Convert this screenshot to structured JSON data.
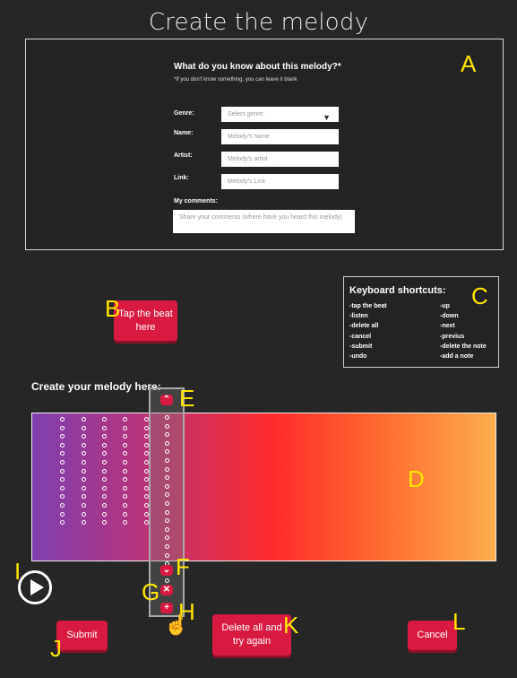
{
  "page": {
    "title": "Create the melody"
  },
  "form": {
    "question": "What do you know about this melody?*",
    "hint": "*If you don't know something, you can leave it blank",
    "genre_label": "Genre:",
    "genre_placeholder": "Select genre:",
    "name_label": "Name:",
    "name_placeholder": "Melody's name",
    "artist_label": "Artist:",
    "artist_placeholder": "Melody's artist",
    "link_label": "Link:",
    "link_placeholder": "Melody's Link",
    "comments_label": "My comments:",
    "comments_placeholder": "Share your comments (where have you heard this melody)"
  },
  "tap_button": "Tap the beat here",
  "shortcuts": {
    "title": "Keyboard shortcuts:",
    "left": [
      "-tap the beat",
      "-listen",
      "-delete all",
      "-cancel",
      "-submit",
      "-undo"
    ],
    "right": [
      "-up",
      "-down",
      "-next",
      "-previus",
      "-delete the note",
      "-add a note"
    ]
  },
  "editor": {
    "heading": "Create your melody here:"
  },
  "buttons": {
    "submit": "Submit",
    "delete_all": "Delete all and try again",
    "cancel": "Cancel"
  },
  "annotations": {
    "A": "A",
    "B": "B",
    "C": "C",
    "D": "D",
    "E": "E",
    "F": "F",
    "G": "G",
    "H": "H",
    "I": "I",
    "J": "J",
    "K": "K",
    "L": "L"
  },
  "colors": {
    "accent": "#d81a40",
    "label_yellow": "#ffe600",
    "gradient": [
      "#7f3fb0",
      "#b3347f",
      "#ff2b2b",
      "#fcae4e"
    ]
  },
  "icons": {
    "up": "chevron-up-icon",
    "down": "chevron-down-icon",
    "delete": "close-icon",
    "add": "plus-icon",
    "play": "play-icon",
    "cursor": "hand-pointer-icon"
  }
}
